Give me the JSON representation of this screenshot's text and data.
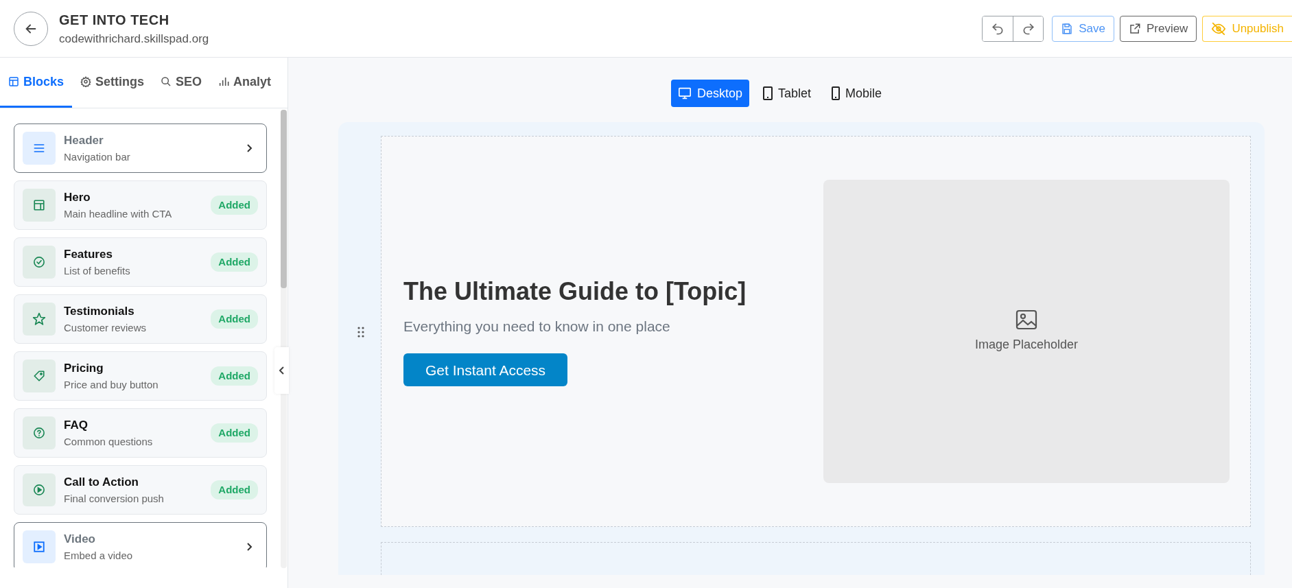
{
  "header": {
    "title": "GET INTO TECH",
    "subtitle": "codewithrichard.skillspad.org",
    "actions": [
      {
        "label": "Save",
        "kind": "save"
      },
      {
        "label": "Preview",
        "kind": "preview"
      },
      {
        "label": "Unpublish",
        "kind": "unpublish"
      }
    ]
  },
  "sidebar": {
    "tabs": [
      {
        "label": "Blocks",
        "selected": true
      },
      {
        "label": "Settings",
        "selected": false
      },
      {
        "label": "SEO",
        "selected": false
      },
      {
        "label": "Analyt",
        "selected": false
      }
    ],
    "blocks": [
      {
        "title": "Header",
        "description": "Navigation bar",
        "added": false
      },
      {
        "title": "Hero",
        "description": "Main headline with CTA",
        "added": true,
        "badge": "Added"
      },
      {
        "title": "Features",
        "description": "List of benefits",
        "added": true,
        "badge": "Added"
      },
      {
        "title": "Testimonials",
        "description": "Customer reviews",
        "added": true,
        "badge": "Added"
      },
      {
        "title": "Pricing",
        "description": "Price and buy button",
        "added": true,
        "badge": "Added"
      },
      {
        "title": "FAQ",
        "description": "Common questions",
        "added": true,
        "badge": "Added"
      },
      {
        "title": "Call to Action",
        "description": "Final conversion push",
        "added": true,
        "badge": "Added"
      },
      {
        "title": "Video",
        "description": "Embed a video",
        "added": false
      }
    ]
  },
  "devices": [
    {
      "label": "Desktop",
      "selected": true
    },
    {
      "label": "Tablet",
      "selected": false
    },
    {
      "label": "Mobile",
      "selected": false
    }
  ],
  "hero": {
    "heading": "The Ultimate Guide to [Topic]",
    "subheading": "Everything you need to know in one place",
    "button": "Get Instant Access",
    "image_label": "Image Placeholder"
  }
}
